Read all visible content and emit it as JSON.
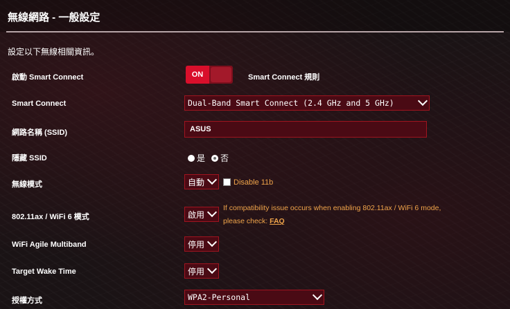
{
  "header": {
    "title": "無線網路 - 一般設定"
  },
  "description": "設定以下無線相關資訊。",
  "rows": {
    "smart_connect_enable": {
      "label": "啟動 Smart Connect",
      "toggle_value": "ON",
      "rule_link": "Smart Connect 規則"
    },
    "smart_connect": {
      "label": "Smart Connect",
      "value": "Dual-Band Smart Connect (2.4 GHz and 5 GHz)"
    },
    "ssid": {
      "label": "網路名稱 (SSID)",
      "value": "ASUS"
    },
    "hide_ssid": {
      "label": "隱藏 SSID",
      "yes": "是",
      "no": "否",
      "selected": "否"
    },
    "wireless_mode": {
      "label": "無線模式",
      "value": "自動",
      "checkbox_label": "Disable 11b",
      "checked": false
    },
    "ax_mode": {
      "label": "802.11ax / WiFi 6 模式",
      "value": "啟用",
      "warning": "If compatibility issue occurs when enabling 802.11ax / WiFi 6 mode,",
      "warning2": "please check:",
      "faq": "FAQ"
    },
    "agile_multiband": {
      "label": "WiFi Agile Multiband",
      "value": "停用"
    },
    "target_wake_time": {
      "label": "Target Wake Time",
      "value": "停用"
    },
    "auth_method": {
      "label": "授權方式",
      "value": "WPA2-Personal"
    }
  },
  "colors": {
    "accent": "#d90f2b",
    "warning": "#f0a44a",
    "field_bg": "#4a0a14"
  }
}
